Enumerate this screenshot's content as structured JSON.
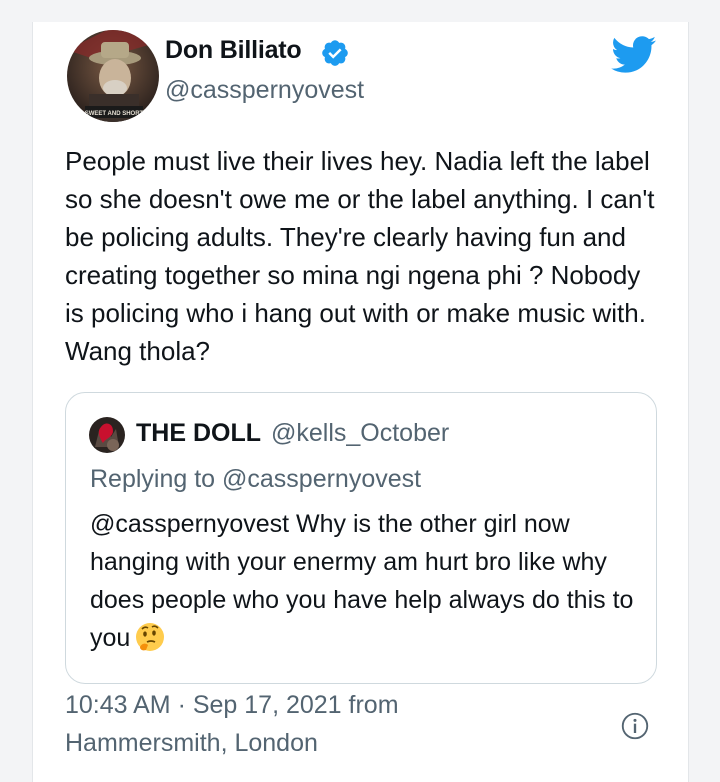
{
  "tweet": {
    "author_name": "Don Billiato",
    "author_handle": "@casspernyovest",
    "avatar_caption": "SWEET AND SHORT",
    "text": "People must live their lives hey. Nadia left the label so she doesn't owe me or the label anything. I can't be policing adults. They're clearly having fun and creating together so mina ngi ngena phi ? Nobody is policing who i hang out with or make music with. Wang thola?",
    "timestamp": "10:43 AM · Sep 17, 2021 from Hammersmith, London"
  },
  "quote": {
    "author_name": "THE DOLL",
    "author_handle": "@kells_October",
    "replying_to": "Replying to @casspernyovest",
    "text": "@casspernyovest Why is the other girl now hanging with your enermy am hurt bro like why does people who you have help always do this to you"
  },
  "icons": {
    "verified": "verified-badge-icon",
    "brand": "twitter-bird-icon",
    "emoji": "thinking-face-emoji",
    "info": "info-icon"
  },
  "colors": {
    "brand_blue": "#1d9bf0",
    "text_primary": "#0f1419",
    "text_secondary": "#536471",
    "border": "#cfd9de"
  }
}
